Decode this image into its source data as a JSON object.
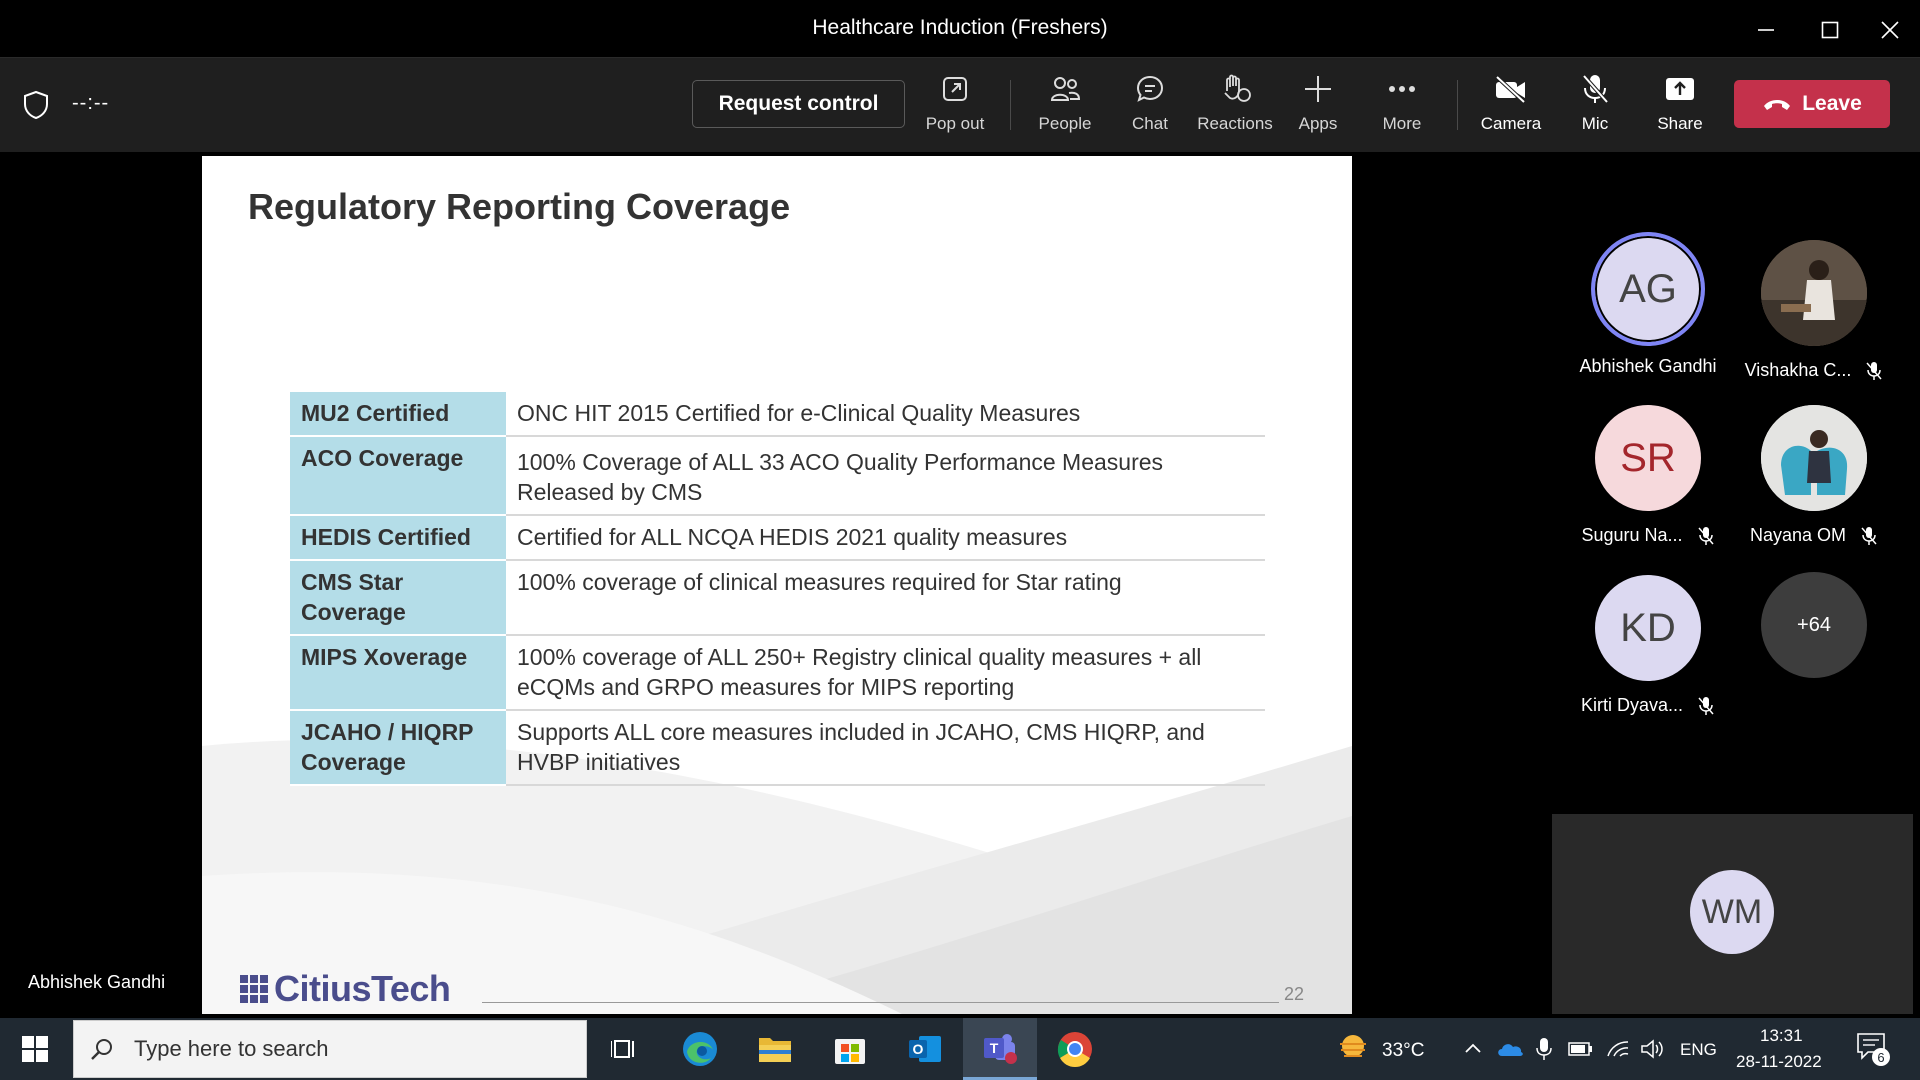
{
  "window": {
    "title": "Healthcare Induction (Freshers)"
  },
  "toolbar": {
    "timer": "--:--",
    "request_control": "Request control",
    "pop_out": "Pop out",
    "people": "People",
    "chat": "Chat",
    "reactions": "Reactions",
    "apps": "Apps",
    "more": "More",
    "camera": "Camera",
    "mic": "Mic",
    "share": "Share",
    "leave": "Leave",
    "leave_color": "#c4314b"
  },
  "slide": {
    "title": "Regulatory Reporting Coverage",
    "rows": [
      {
        "label": "MU2 Certified",
        "text": "ONC HIT 2015 Certified for e-Clinical Quality Measures"
      },
      {
        "label": "ACO Coverage",
        "text": "100% Coverage of ALL 33 ACO Quality Performance Measures Released by CMS"
      },
      {
        "label": "HEDIS Certified",
        "text": "Certified for ALL NCQA HEDIS 2021 quality measures"
      },
      {
        "label": "CMS Star Coverage",
        "text": "100% coverage of clinical measures required for Star rating"
      },
      {
        "label": "MIPS Xoverage",
        "text": "100% coverage of ALL 250+ Registry clinical quality measures + all eCQMs and GRPO measures for MIPS reporting"
      },
      {
        "label": "JCAHO / HIQRP Coverage",
        "text": "Supports ALL core measures included in JCAHO, CMS HIQRP, and HVBP initiatives"
      }
    ],
    "logo_text": "CitiusTech",
    "page_number": "22",
    "header_cell_color": "#b4dde8"
  },
  "presenter_name": "Abhishek Gandhi",
  "participants": [
    {
      "initials": "AG",
      "name": "Abhishek Gandhi",
      "muted": false,
      "speaking": true
    },
    {
      "initials": "",
      "name": "Vishakha C...",
      "muted": true,
      "photo": true
    },
    {
      "initials": "SR",
      "name": "Suguru Na...",
      "muted": true
    },
    {
      "initials": "",
      "name": "Nayana OM",
      "muted": true,
      "photo": true
    },
    {
      "initials": "KD",
      "name": "Kirti Dyava...",
      "muted": true
    },
    {
      "initials": "+64",
      "name": "",
      "muted": false
    }
  ],
  "self_tile": {
    "initials": "WM"
  },
  "taskbar": {
    "search_placeholder": "Type here to search",
    "weather": "33°C",
    "language": "ENG",
    "time": "13:31",
    "date": "28-11-2022",
    "notification_count": "6"
  }
}
